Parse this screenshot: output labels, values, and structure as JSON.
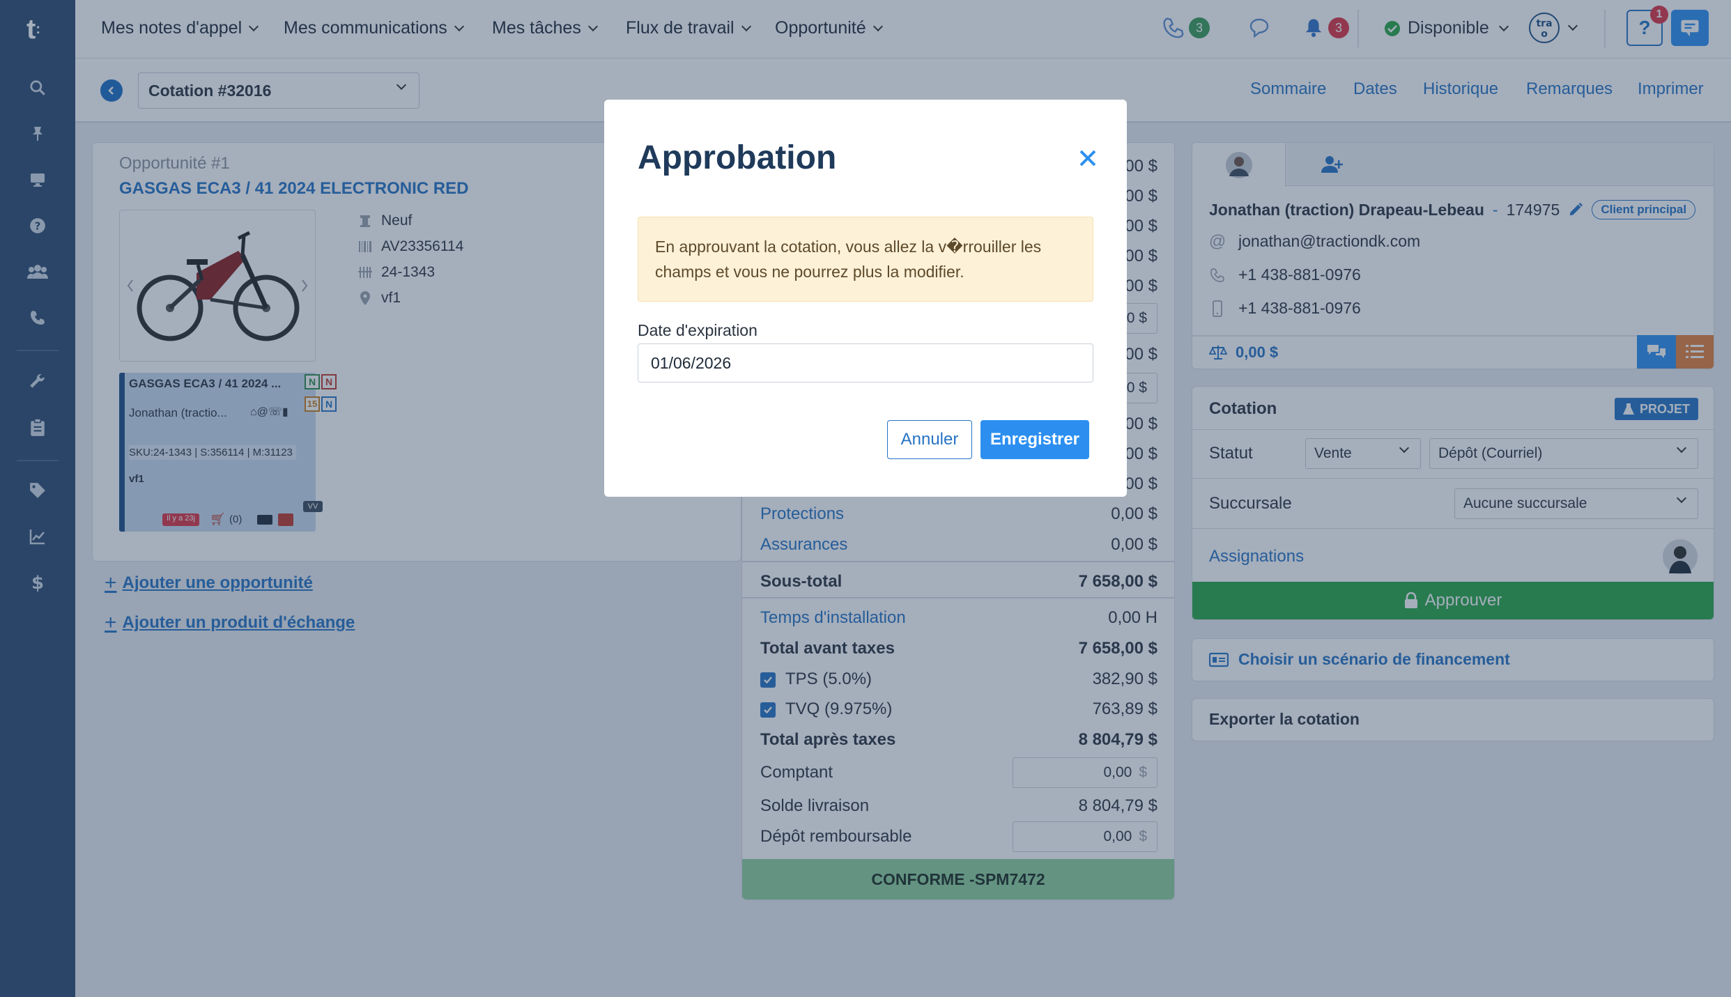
{
  "topbar": {
    "menu": [
      "Mes notes d'appel",
      "Mes communications",
      "Mes tâches",
      "Flux de travail",
      "Opportunité"
    ],
    "calls_count": "3",
    "notifications_count": "3",
    "status": "Disponible",
    "help_count": "1"
  },
  "subheader": {
    "quote": "Cotation #32016",
    "nav": [
      "Sommaire",
      "Dates",
      "Historique",
      "Remarques",
      "Imprimer"
    ]
  },
  "opportunity": {
    "number": "Opportunité #1",
    "name": "GASGAS ECA3 / 41 2024 ELECTRONIC RED",
    "condition": "Neuf",
    "vin": "AV23356114",
    "stock": "24-1343",
    "location": "vf1",
    "card": {
      "title": "GASGAS ECA3 / 41 2024 ...",
      "client": "Jonathan (tractio...",
      "sku": "SKU:24-1343 | S:356114 | M:31123",
      "loc": "vf1",
      "badge_n1": "N",
      "badge_n2": "N",
      "badge_15": "15",
      "badge_n3": "N",
      "age": "Il y a 23j",
      "cart": "(0)",
      "vv": "VV"
    }
  },
  "links": {
    "add_opportunity": "Ajouter une opportunité",
    "add_trade": "Ajouter un produit d'échange"
  },
  "totals": {
    "hidden_values": [
      "00 $",
      "00 $",
      "00 $",
      "00 $",
      "00 $",
      "0 $",
      "00 $",
      "0 $",
      "00 $",
      "00 $",
      "00 $"
    ],
    "protections_label": "Protections",
    "protections": "0,00 $",
    "assurances_label": "Assurances",
    "assurances": "0,00 $",
    "subtotal_label": "Sous-total",
    "subtotal": "7 658,00 $",
    "install_label": "Temps d'installation",
    "install": "0,00 H",
    "before_tax_label": "Total avant taxes",
    "before_tax": "7 658,00 $",
    "tps_label": "TPS (5.0%)",
    "tps": "382,90 $",
    "tvq_label": "TVQ (9.975%)",
    "tvq": "763,89 $",
    "after_tax_label": "Total après taxes",
    "after_tax": "8 804,79 $",
    "cash_label": "Comptant",
    "cash": "0,00",
    "delivery_label": "Solde livraison",
    "delivery": "8 804,79 $",
    "deposit_label": "Dépôt remboursable",
    "deposit": "0,00",
    "currency": "$",
    "conform": "CONFORME -SPM7472"
  },
  "client": {
    "name": "Jonathan (traction) Drapeau-Lebeau",
    "dash": "-",
    "id": "174975",
    "badge": "Client principal",
    "email": "jonathan@tractiondk.com",
    "phone": "+1 438-881-0976",
    "mobile": "+1 438-881-0976",
    "balance": "0,00 $"
  },
  "cotation": {
    "title": "Cotation",
    "projet": "PROJET",
    "statut_label": "Statut",
    "statut_type": "Vente",
    "statut_value": "Dépôt (Courriel)",
    "succursale_label": "Succursale",
    "succursale_value": "Aucune succursale",
    "assignations_label": "Assignations",
    "approve": "Approuver"
  },
  "financing": "Choisir un scénario de financement",
  "export": "Exporter la cotation",
  "modal": {
    "title": "Approbation",
    "warning": "En approuvant la cotation, vous allez la v�rrouiller les champs et vous ne pourrez plus la modifier.",
    "date_label": "Date d'expiration",
    "date_value": "01/06/2026",
    "cancel": "Annuler",
    "save": "Enregistrer"
  },
  "colors": {
    "sidebar": "#2c4a6e",
    "accent": "#2574c4",
    "success": "#28a745",
    "primary_button": "#2c8ff0"
  }
}
